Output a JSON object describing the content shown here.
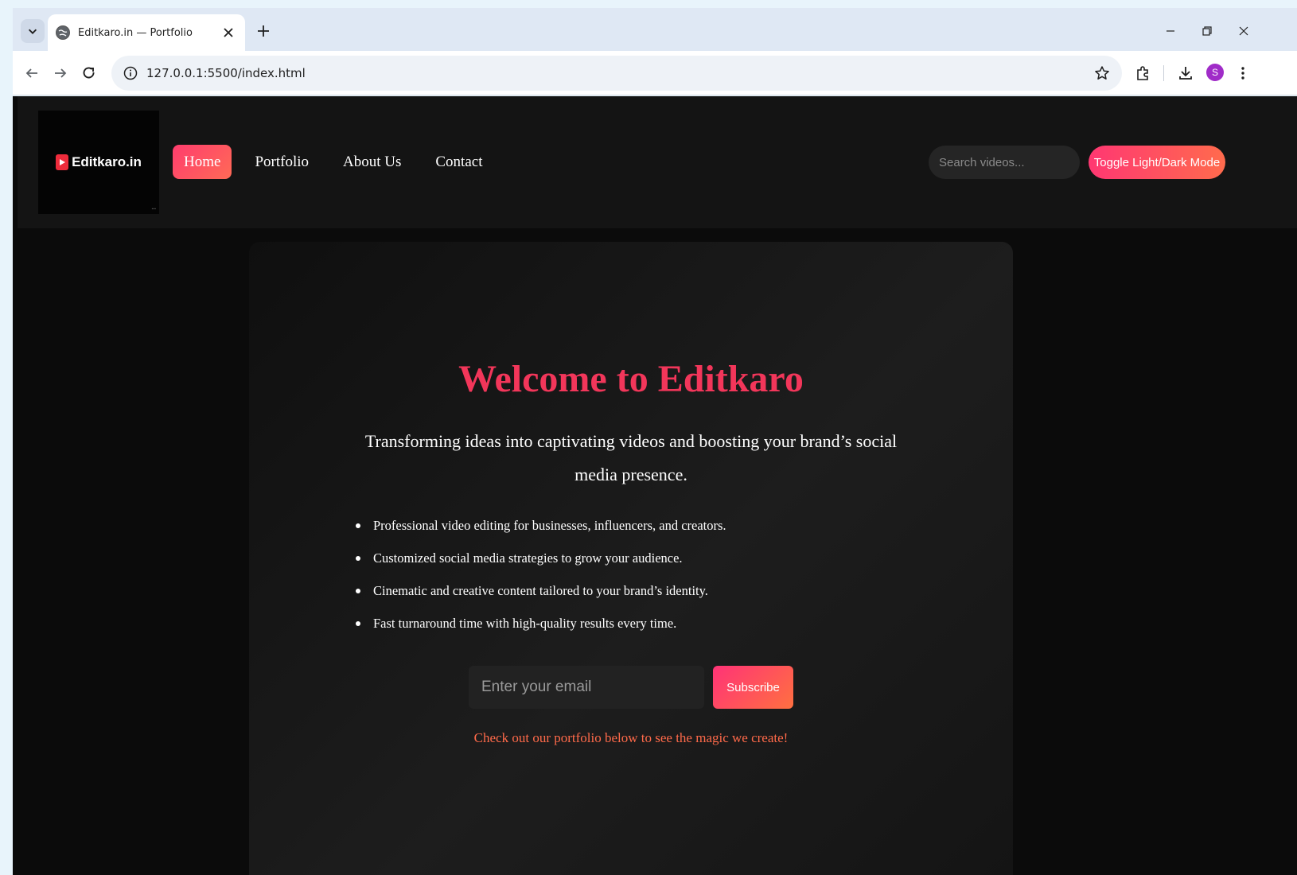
{
  "browser": {
    "tab_title": "Editkaro.in — Portfolio",
    "url": "127.0.0.1:5500/index.html",
    "profile_initial": "S"
  },
  "site": {
    "logo_text": "Editkaro.in",
    "nav": [
      {
        "label": "Home",
        "active": true
      },
      {
        "label": "Portfolio",
        "active": false
      },
      {
        "label": "About Us",
        "active": false
      },
      {
        "label": "Contact",
        "active": false
      }
    ],
    "search_placeholder": "Search videos...",
    "toggle_label": "Toggle Light/Dark Mode"
  },
  "hero": {
    "title": "Welcome to Editkaro",
    "subtitle": "Transforming ideas into captivating videos and boosting your brand’s social media presence.",
    "features": [
      "Professional video editing for businesses, influencers, and creators.",
      "Customized social media strategies to grow your audience.",
      "Cinematic and creative content tailored to your brand’s identity.",
      "Fast turnaround time with high-quality results every time."
    ],
    "email_placeholder": "Enter your email",
    "subscribe_label": "Subscribe",
    "portfolio_note": "Check out our portfolio below to see the magic we create!"
  },
  "colors": {
    "accent": "#f2365a",
    "gradient_start": "#ff3772",
    "gradient_end": "#ff6b4d",
    "page_bg": "#0b0b0b"
  }
}
